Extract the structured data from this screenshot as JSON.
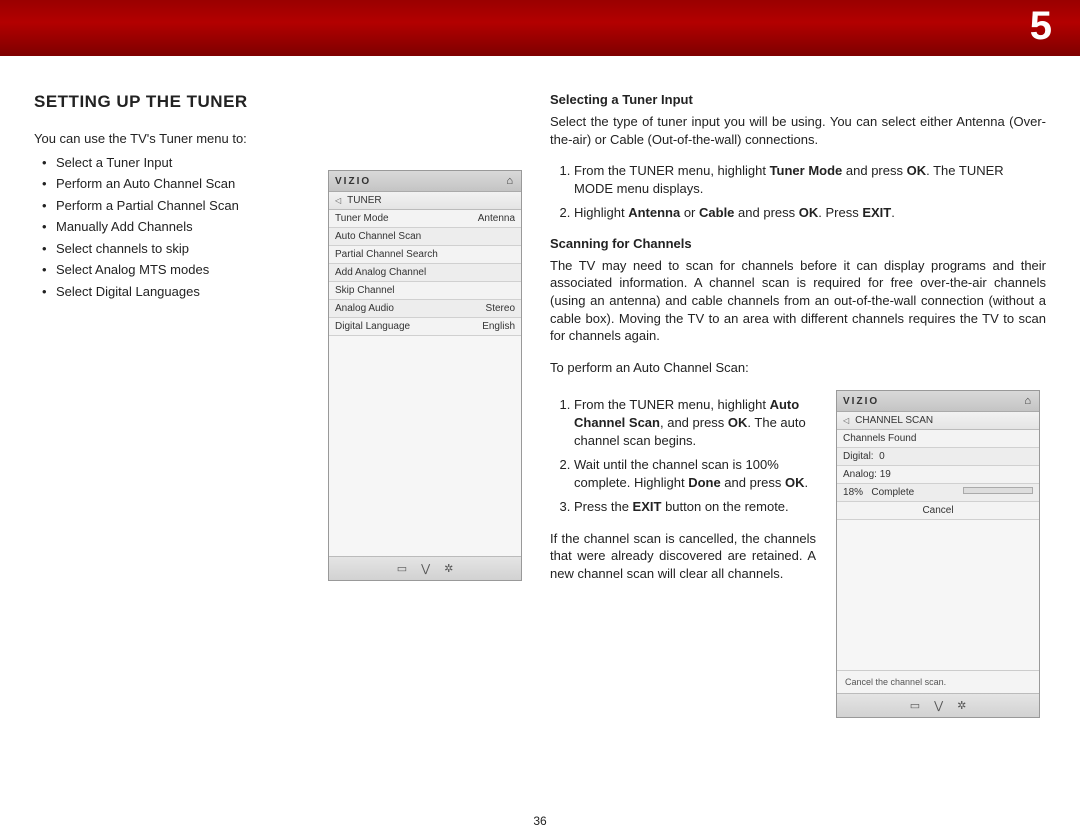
{
  "chapter_number": "5",
  "page_number": "36",
  "left": {
    "heading": "SETTING UP THE TUNER",
    "intro": "You can use the TV's Tuner menu to:",
    "bullets": [
      "Select a Tuner Input",
      "Perform an Auto Channel Scan",
      "Perform a Partial Channel Scan",
      "Manually Add Channels",
      "Select channels to skip",
      "Select Analog MTS modes",
      "Select Digital Languages"
    ]
  },
  "osd_tuner": {
    "brand": "VIZIO",
    "home_glyph": "⌂",
    "crumb_glyph": "◁",
    "crumb": "TUNER",
    "rows": [
      {
        "label": "Tuner Mode",
        "value": "Antenna"
      },
      {
        "label": "Auto Channel Scan",
        "value": ""
      },
      {
        "label": "Partial Channel Search",
        "value": ""
      },
      {
        "label": "Add Analog Channel",
        "value": ""
      },
      {
        "label": "Skip Channel",
        "value": ""
      },
      {
        "label": "Analog Audio",
        "value": "Stereo"
      },
      {
        "label": "Digital Language",
        "value": "English"
      }
    ],
    "footer_icons": [
      "▭",
      "⋁",
      "✲"
    ]
  },
  "right": {
    "sub1": "Selecting a Tuner Input",
    "sub1_text": "Select the type of tuner input you will be using. You can select either Antenna (Over-the-air) or Cable (Out-of-the-wall) connections.",
    "steps1": [
      {
        "pre": "From the TUNER menu, highlight ",
        "b1": "Tuner Mode",
        "mid": " and press ",
        "b2": "OK",
        "post": ". The TUNER MODE menu displays."
      },
      {
        "pre": "Highlight ",
        "b1": "Antenna",
        "mid": " or ",
        "b2": "Cable",
        "mid2": " and press ",
        "b3": "OK",
        "mid3": ". Press ",
        "b4": "EXIT",
        "post": "."
      }
    ],
    "sub2": "Scanning for Channels",
    "sub2_text": "The TV may need to scan for channels before it can display programs and their associated information. A channel scan is required for free over-the-air channels (using an antenna) and cable channels from an out-of-the-wall connection (without a cable box). Moving the TV to an area with different channels requires the TV to scan for channels again.",
    "sub2_lead": "To perform an Auto Channel Scan:",
    "steps2": [
      {
        "pre": "From the TUNER menu, highlight ",
        "b1": "Auto Channel Scan",
        "mid": ", and press ",
        "b2": "OK",
        "post": ". The auto channel scan begins."
      },
      {
        "pre": "Wait until the channel scan is 100% complete. Highlight ",
        "b1": "Done",
        "mid": " and press ",
        "b2": "OK",
        "post": "."
      },
      {
        "pre": "Press the ",
        "b1": "EXIT",
        "post": " button on the remote."
      }
    ],
    "tail": "If the channel scan is cancelled, the channels that were already discovered are retained. A new channel scan will clear all channels."
  },
  "osd_scan": {
    "brand": "VIZIO",
    "home_glyph": "⌂",
    "crumb_glyph": "◁",
    "crumb": "CHANNEL SCAN",
    "found_label": "Channels Found",
    "digital_label": "Digital:",
    "digital_value": "0",
    "analog_label": "Analog:",
    "analog_value": "19",
    "pct": "18%",
    "complete_label": "Complete",
    "progress_pct": 18,
    "cancel": "Cancel",
    "info": "Cancel the channel scan.",
    "footer_icons": [
      "▭",
      "⋁",
      "✲"
    ]
  }
}
